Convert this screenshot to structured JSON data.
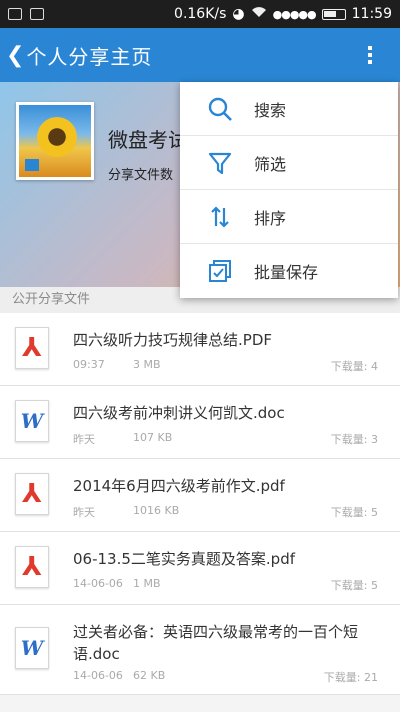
{
  "status_bar": {
    "speed": "0.16K/s",
    "time": "11:59",
    "signal": "●●●●●"
  },
  "app_bar": {
    "back_glyph": "❮",
    "title": "个人分享主页",
    "more_icon": "overflow-menu-icon"
  },
  "profile": {
    "name": "微盘考试",
    "share_info": "分享文件数"
  },
  "section_title": "公开分享文件",
  "files": [
    {
      "name": "四六级听力技巧规律总结.PDF",
      "type": "pdf",
      "time": "09:37",
      "size": "3 MB",
      "downloads": "下载量: 4"
    },
    {
      "name": "四六级考前冲刺讲义何凯文.doc",
      "type": "doc",
      "time": "昨天",
      "size": "107 KB",
      "downloads": "下载量: 3"
    },
    {
      "name": "2014年6月四六级考前作文.pdf",
      "type": "pdf",
      "time": "昨天",
      "size": "1016 KB",
      "downloads": "下载量: 5"
    },
    {
      "name": "06-13.5二笔实务真题及答案.pdf",
      "type": "pdf",
      "time": "14-06-06",
      "size": "1 MB",
      "downloads": "下载量: 5"
    },
    {
      "name": "过关者必备：英语四六级最常考的一百个短语.doc",
      "type": "doc",
      "time": "14-06-06",
      "size": "62 KB",
      "downloads": "下载量: 21"
    }
  ],
  "menu": [
    {
      "label": "搜索",
      "icon": "search-icon"
    },
    {
      "label": "筛选",
      "icon": "filter-icon"
    },
    {
      "label": "排序",
      "icon": "sort-icon"
    },
    {
      "label": "批量保存",
      "icon": "batch-save-icon"
    }
  ],
  "colors": {
    "accent": "#2a86d4",
    "pdf": "#e03a2f",
    "doc": "#2f6ec7"
  }
}
